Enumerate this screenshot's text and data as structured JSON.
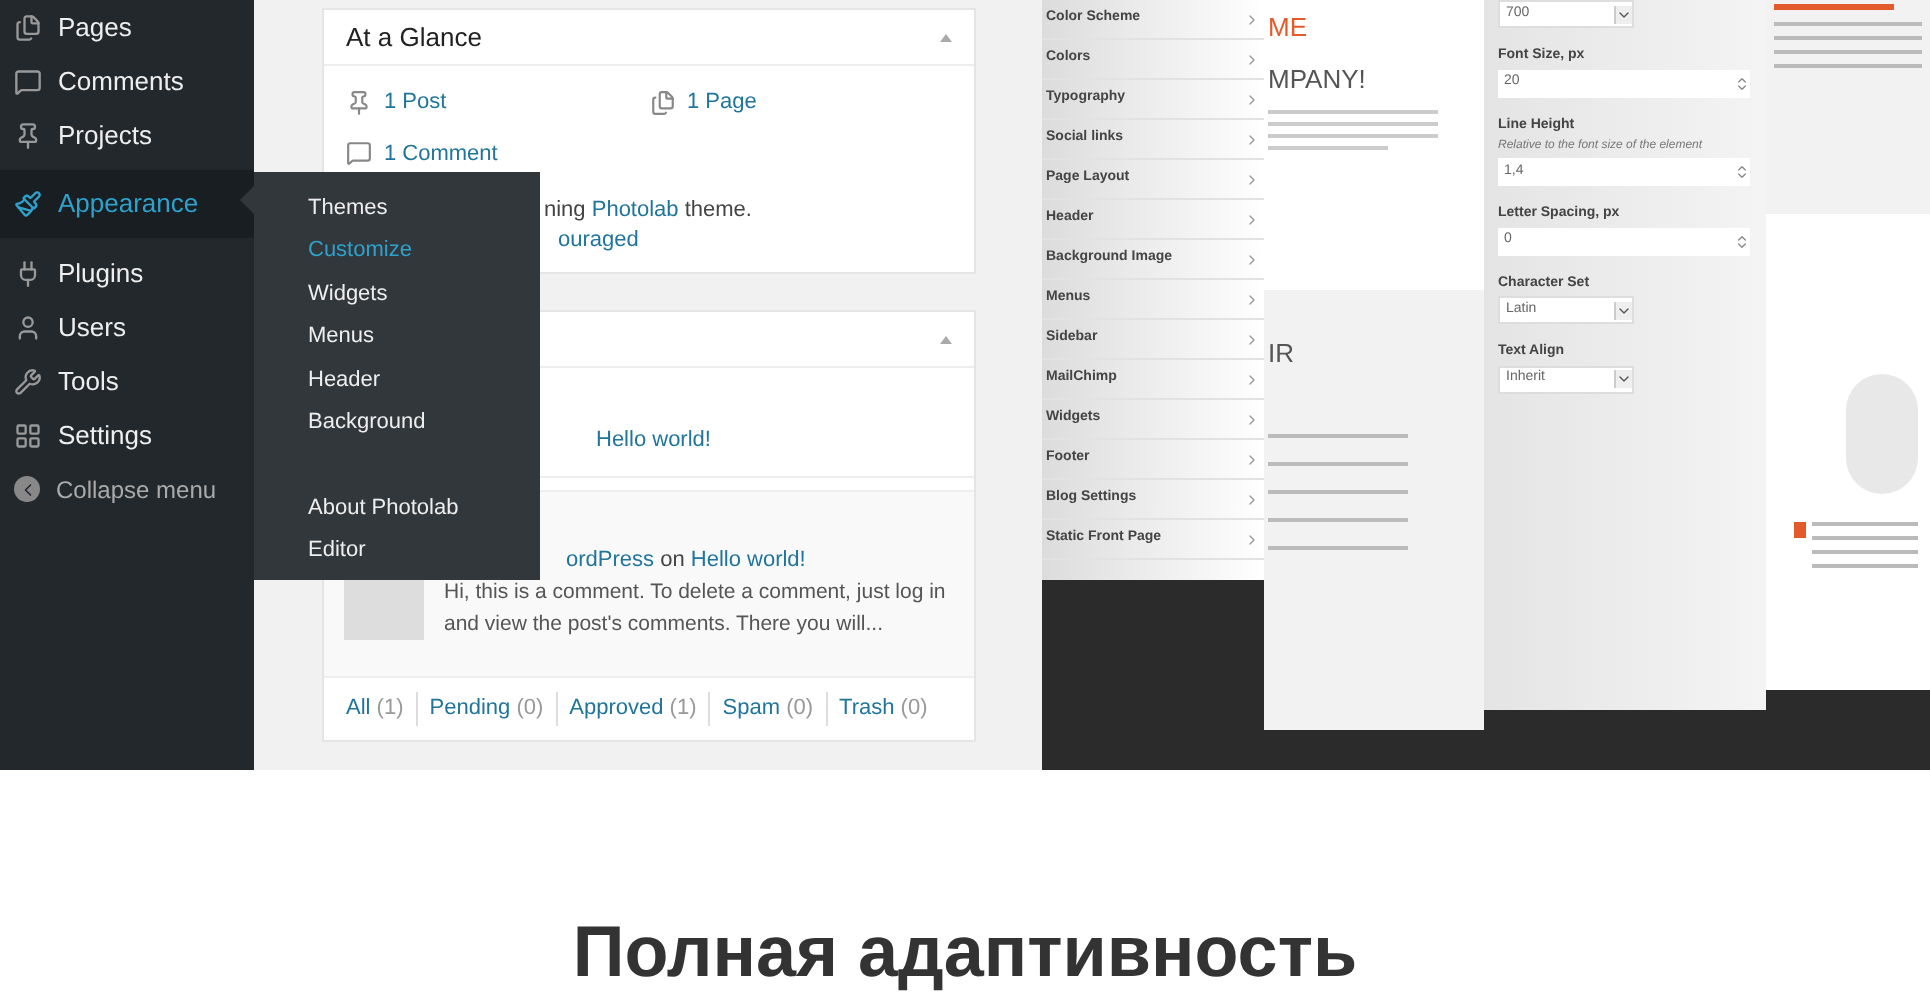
{
  "sidebar": {
    "items": [
      {
        "label": "Pages",
        "selected": false
      },
      {
        "label": "Comments",
        "selected": false
      },
      {
        "label": "Projects",
        "selected": false
      },
      {
        "label": "Appearance",
        "selected": true
      },
      {
        "label": "Plugins",
        "selected": false
      },
      {
        "label": "Users",
        "selected": false
      },
      {
        "label": "Tools",
        "selected": false
      },
      {
        "label": "Settings",
        "selected": false
      }
    ],
    "collapse": "Collapse menu"
  },
  "flyout": {
    "groups": [
      [
        {
          "label": "Themes",
          "selected": false
        },
        {
          "label": "Customize",
          "selected": true
        },
        {
          "label": "Widgets",
          "selected": false
        },
        {
          "label": "Menus",
          "selected": false
        },
        {
          "label": "Header",
          "selected": false
        },
        {
          "label": "Background",
          "selected": false
        }
      ],
      [
        {
          "label": "About Photolab",
          "selected": false
        },
        {
          "label": "Editor",
          "selected": false
        }
      ]
    ]
  },
  "glance": {
    "title": "At a Glance",
    "stats": [
      {
        "kind": "post",
        "label": "1 Post"
      },
      {
        "kind": "page",
        "label": "1 Page"
      },
      {
        "kind": "comment",
        "label": "1 Comment"
      }
    ],
    "theme_prefix": "ning ",
    "theme_link": "Photolab",
    "theme_suffix": " theme.",
    "second_line": "ouraged"
  },
  "activity": {
    "post_link": "Hello world!",
    "comment_author": "ordPress",
    "comment_on": " on ",
    "comment_post": "Hello world!",
    "comment_text": "Hi, this is a comment. To delete a comment, just log in and view the post's comments. There you will...",
    "filters": [
      {
        "label": "All",
        "count": "(1)"
      },
      {
        "label": "Pending",
        "count": "(0)"
      },
      {
        "label": "Approved",
        "count": "(1)"
      },
      {
        "label": "Spam",
        "count": "(0)"
      },
      {
        "label": "Trash",
        "count": "(0)"
      }
    ]
  },
  "mockup": {
    "menu_items": [
      "Color Scheme",
      "Colors",
      "Typography",
      "Social links",
      "Page Layout",
      "Header",
      "Background Image",
      "Menus",
      "Sidebar",
      "MailChimp",
      "Widgets",
      "Footer",
      "Blog Settings",
      "Static Front Page"
    ],
    "preview_accent": "ME",
    "preview_title": "MPANY!",
    "preview_section": "IR",
    "settings": [
      {
        "kind": "select",
        "value": "700"
      },
      {
        "kind": "number",
        "label": "Font Size, px",
        "value": "20"
      },
      {
        "kind": "number",
        "label": "Line Height",
        "hint": "Relative to the font size of the element",
        "value": "1,4"
      },
      {
        "kind": "number",
        "label": "Letter Spacing, px",
        "value": "0"
      },
      {
        "kind": "select",
        "label": "Character Set",
        "value": "Latin"
      },
      {
        "kind": "select",
        "label": "Text Align",
        "value": "Inherit"
      }
    ]
  },
  "heading": "Полная адаптивность"
}
